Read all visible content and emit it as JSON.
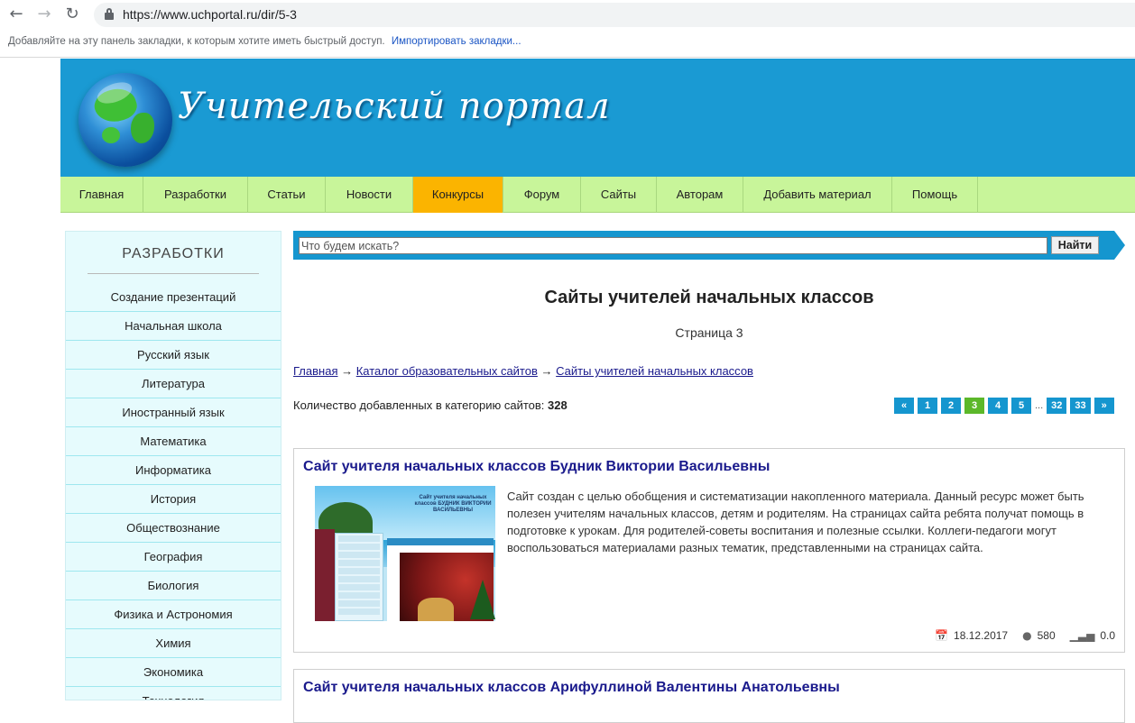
{
  "browser": {
    "url": "https://www.uchportal.ru/dir/5-3",
    "bookmarks_hint": "Добавляйте на эту панель закладки, к которым хотите иметь быстрый доступ.",
    "bookmarks_import": "Импортировать закладки..."
  },
  "header": {
    "logo_text": "Учительский портал"
  },
  "nav": {
    "items": [
      {
        "label": "Главная",
        "active": false
      },
      {
        "label": "Разработки",
        "active": false
      },
      {
        "label": "Статьи",
        "active": false
      },
      {
        "label": "Новости",
        "active": false
      },
      {
        "label": "Конкурсы",
        "active": true
      },
      {
        "label": "Форум",
        "active": false
      },
      {
        "label": "Сайты",
        "active": false
      },
      {
        "label": "Авторам",
        "active": false
      },
      {
        "label": "Добавить материал",
        "active": false
      },
      {
        "label": "Помощь",
        "active": false
      }
    ]
  },
  "sidebar": {
    "title": "РАЗРАБОТКИ",
    "items": [
      "Создание презентаций",
      "Начальная школа",
      "Русский язык",
      "Литература",
      "Иностранный язык",
      "Математика",
      "Информатика",
      "История",
      "Обществознание",
      "География",
      "Биология",
      "Физика и Астрономия",
      "Химия",
      "Экономика",
      "Технология"
    ]
  },
  "search": {
    "placeholder": "Что будем искать?",
    "button": "Найти"
  },
  "content": {
    "title": "Сайты учителей начальных классов",
    "subtitle": "Страница 3",
    "breadcrumb": {
      "home": "Главная",
      "sep": "→",
      "catalog": "Каталог образовательных сайтов",
      "current": "Сайты учителей начальных классов"
    },
    "count_label": "Количество добавленных в категорию сайтов:",
    "count_value": "328",
    "pager": {
      "prev": "«",
      "pages": [
        "1",
        "2",
        "3",
        "4",
        "5"
      ],
      "current": "3",
      "dots": "...",
      "last_pages": [
        "32",
        "33"
      ],
      "next": "»"
    }
  },
  "entries": [
    {
      "title": "Сайт учителя начальных классов Будник Виктории Васильевны",
      "description": "Сайт создан с целью обобщения и систематизации накопленного материала. Данный ресурс может быть полезен учителям начальных классов,  детям и родителям. На страницах сайта ребята получат помощь в подготовке к урокам. Для родителей-советы воспитания и полезные ссылки. Коллеги-педагоги могут воспользоваться материалами разных тематик, представленными на страницах сайта.",
      "thumb_title": "Сайт учителя начальных классов БУДНИК ВИКТОРИИ ВАСИЛЬЕВНЫ",
      "date": "18.12.2017",
      "views": "580",
      "rating": "0.0"
    },
    {
      "title": "Сайт учителя начальных классов Арифуллиной Валентины Анатольевны"
    }
  ],
  "colors": {
    "header_bg": "#1a9ad3",
    "nav_bg": "#c8f59a",
    "nav_active": "#fbb400",
    "sidebar_bg": "#e6fbfd",
    "pager_bg": "#1596cf",
    "pager_current": "#5cb82a",
    "link": "#1a1a8c"
  }
}
